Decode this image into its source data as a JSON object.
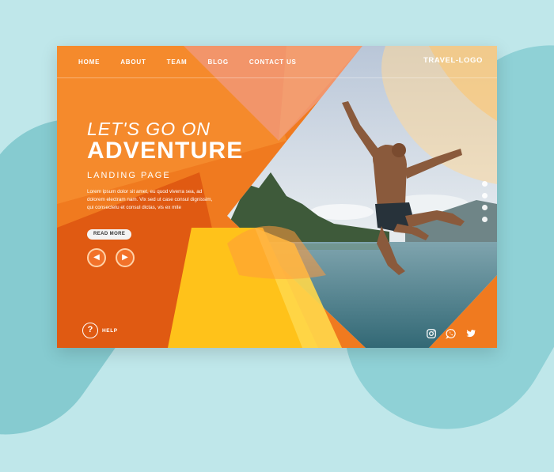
{
  "nav": {
    "items": [
      {
        "label": "HOME"
      },
      {
        "label": "ABOUT"
      },
      {
        "label": "TEAM"
      },
      {
        "label": "BLOG"
      },
      {
        "label": "CONTACT US"
      }
    ],
    "logo": "TRAVEL-LOGO"
  },
  "hero": {
    "pre_title": "LET'S GO ON",
    "title": "ADVENTURE",
    "subtitle": "LANDING PAGE",
    "body": "Lorem ipsum dolor sit amet, eu quod viverra sea, ad dolorem electram nam. Vix sed ut case consul dignissim, qui consectetu et consul dictas, vis ex mite",
    "read_more": "READ MORE"
  },
  "help": {
    "label": "HELP",
    "icon_glyph": "?"
  },
  "carousel": {
    "prev_glyph": "◀",
    "next_glyph": "▶",
    "dot_count": 4
  },
  "social": [
    "instagram-icon",
    "whatsapp-icon",
    "twitter-icon"
  ],
  "colors": {
    "primary_orange": "#f07a1f",
    "dark_orange": "#e35d12",
    "yellow": "#ffc21a",
    "peach": "#ffd39a",
    "sky": "#c8d8e2",
    "water": "#4d7f8b"
  }
}
